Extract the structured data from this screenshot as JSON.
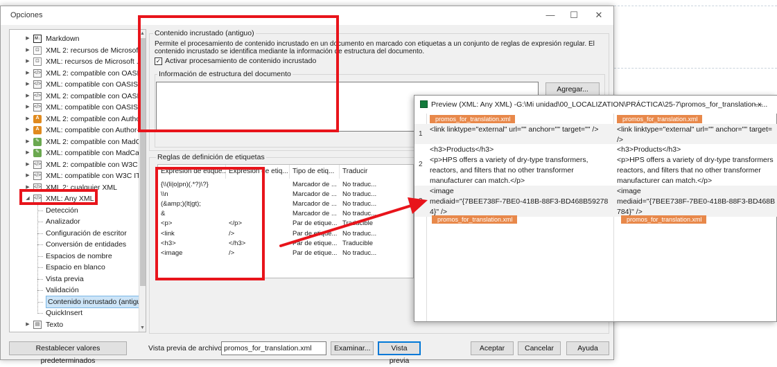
{
  "dialog": {
    "title": "Opciones",
    "controls": {
      "minimize": "—",
      "maximize": "☐",
      "close": "✕"
    }
  },
  "tree": {
    "items": [
      {
        "label": "Markdown",
        "icon": "md-icon",
        "iconText": "M↓"
      },
      {
        "label": "XML 2: recursos de Microsoft .",
        "icon": "xml-ms-icon",
        "iconText": "⊡"
      },
      {
        "label": "XML: recursos de Microsoft .NE",
        "icon": "xml-ms-icon",
        "iconText": "⊡"
      },
      {
        "label": "XML 2: compatible con OASIS",
        "icon": "xml-icon",
        "iconText": "</>"
      },
      {
        "label": "XML: compatible con OASIS DI",
        "icon": "xml-icon",
        "iconText": "</>"
      },
      {
        "label": "XML 2: compatible con OASIS",
        "icon": "xml-icon",
        "iconText": "</>"
      },
      {
        "label": "XML: compatible con OASIS Do",
        "icon": "xml-icon",
        "iconText": "</>"
      },
      {
        "label": "XML 2: compatible con Author-",
        "icon": "author-icon",
        "iconText": "A"
      },
      {
        "label": "XML: compatible con Author-it",
        "icon": "author-icon",
        "iconText": "A"
      },
      {
        "label": "XML 2: compatible con MadCa",
        "icon": "madcap-icon",
        "iconText": "✎"
      },
      {
        "label": "XML: compatible con MadCap",
        "icon": "madcap-icon",
        "iconText": "✎"
      },
      {
        "label": "XML 2: compatible con W3C IT",
        "icon": "xml-icon",
        "iconText": "</>"
      },
      {
        "label": "XML: compatible con W3C ITS",
        "icon": "xml-icon",
        "iconText": "</>"
      },
      {
        "label": "XML 2: cualquier XML",
        "icon": "xml-icon",
        "iconText": "</>"
      },
      {
        "label": "XML: Any XML",
        "icon": "xml-icon",
        "iconText": "</>"
      }
    ],
    "children": [
      "Detección",
      "Analizador",
      "Configuración de escritor",
      "Conversión de entidades",
      "Espacios de nombre",
      "Espacio en blanco",
      "Vista previa",
      "Validación",
      "Contenido incrustado (antiguo)",
      "QuickInsert"
    ],
    "after": [
      {
        "label": "Texto",
        "icon": "text-icon",
        "iconText": "▤"
      }
    ]
  },
  "embedded": {
    "group_title": "Contenido incrustado (antiguo)",
    "description_1": "Permite el procesamiento de contenido incrustado en un documento en marcado con etiquetas a un conjunto de reglas de expresión regular. El",
    "description_2": "contenido incrustado se identifica mediante la información de estructura del documento.",
    "checkbox_label": "Activar procesamiento de contenido incrustado",
    "checkbox_checked": "✓",
    "structure_title": "Información de estructura del documento",
    "add_button": "Agregar..."
  },
  "rules": {
    "group_title": "Reglas de definición de etiquetas",
    "columns": [
      "Expresión de etique...",
      "Expresión de etiq...",
      "Tipo de etiq...",
      "Traducir"
    ],
    "rows": [
      {
        "start": "{\\\\(li|o|pn)(.*?)\\?}",
        "end": "",
        "type": "Marcador de ...",
        "translate": "No traduc..."
      },
      {
        "start": "\\\\n",
        "end": "",
        "type": "Marcador de ...",
        "translate": "No traduc..."
      },
      {
        "start": "(&amp;)(lt|gt);",
        "end": "",
        "type": "Marcador de ...",
        "translate": "No traduc..."
      },
      {
        "start": "&",
        "end": "",
        "type": "Marcador de ...",
        "translate": "No traduc..."
      },
      {
        "start": "<p>",
        "end": "</p>",
        "type": "Par de etique...",
        "translate": "Traducible"
      },
      {
        "start": "<link",
        "end": "/>",
        "type": "Par de etique...",
        "translate": "No traduc..."
      },
      {
        "start": "<h3>",
        "end": "</h3>",
        "type": "Par de etique...",
        "translate": "Traducible"
      },
      {
        "start": "<image",
        "end": "/>",
        "type": "Par de etique...",
        "translate": "No traduc..."
      }
    ]
  },
  "footer": {
    "reset_button": "Restablecer valores predeterminados",
    "preview_file_label": "Vista previa de archivo:",
    "preview_file_value": "promos_for_translation.xml",
    "browse_button": "Examinar...",
    "preview_button": "Vista previa",
    "ok_button": "Aceptar",
    "cancel_button": "Cancelar",
    "help_button": "Ayuda"
  },
  "preview": {
    "title": "Preview (XML: Any XML) -G:\\Mi unidad\\00_LOCALIZATION\\PRÁCTICA\\25-7\\promos_for_translation.x...",
    "minimize": "—",
    "tag": "promos_for_translation.xml",
    "segments": [
      {
        "num": "1",
        "source": [
          "<link linktype=\"external\" url=\"\" anchor=\"\" target=\"\" />"
        ],
        "target": [
          "<link linktype=\"external\" url=\"\" anchor=\"\" target=",
          "/>"
        ]
      },
      {
        "num": "2",
        "source": [
          "<h3>Products</h3>",
          "<p>HPS offers a variety of dry-type transformers,",
          "reactors, and filters that no other transformer",
          "manufacturer can match.</p>"
        ],
        "target": [
          "<h3>Products</h3>",
          "<p>HPS offers a variety of dry-type transformers",
          "reactors, and filters that no other transformer",
          "manufacturer can match.</p>"
        ]
      },
      {
        "num": "3",
        "source": [
          "<image",
          "mediaid=\"{7BEE738F-7BE0-418B-88F3-BD468B59278",
          "4}\" />"
        ],
        "target": [
          "<image",
          "mediaid=\"{7BEE738F-7BE0-418B-88F3-BD468B",
          "784}\" />"
        ]
      }
    ]
  },
  "colors": {
    "annotation_red": "#e8141b",
    "tag_orange": "#e8884a",
    "selection_blue": "#cce4f7"
  }
}
